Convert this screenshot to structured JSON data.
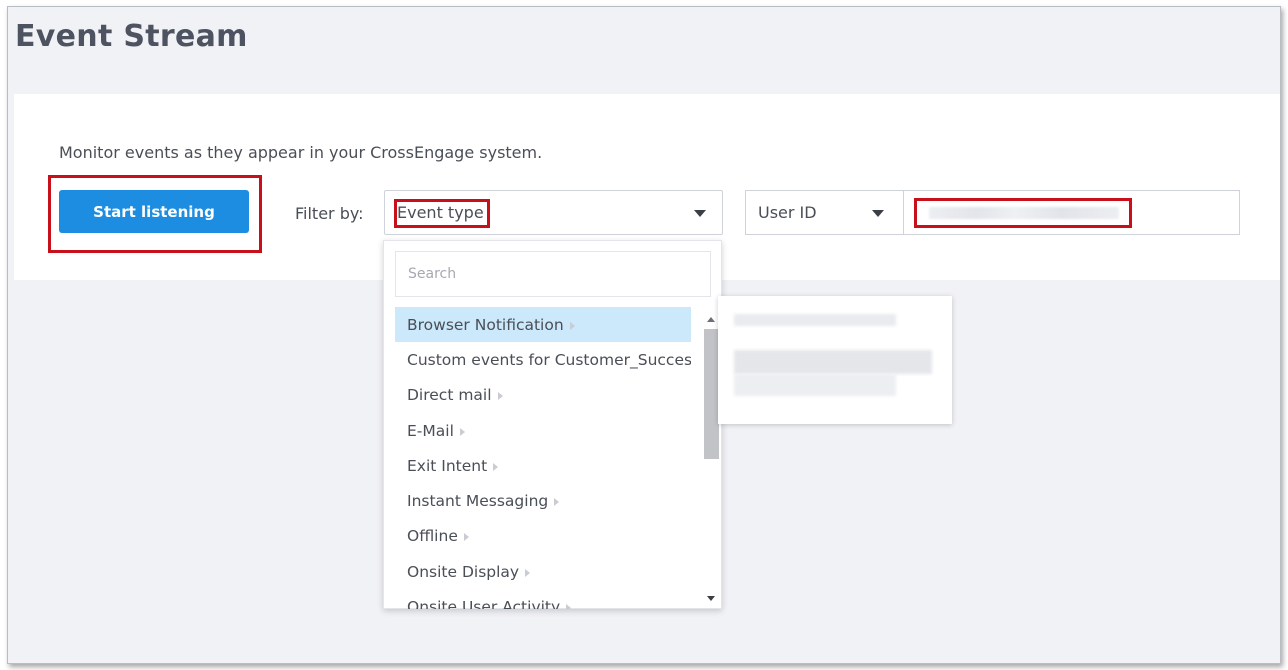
{
  "page": {
    "title": "Event Stream"
  },
  "panel": {
    "description": "Monitor events as they appear in your CrossEngage system.",
    "start_button": "Start listening",
    "filter_label": "Filter by:",
    "event_select": {
      "value": "Event type"
    },
    "user_select": {
      "value": "User ID"
    },
    "user_input": {
      "value": ""
    }
  },
  "dropdown": {
    "search_placeholder": "Search",
    "items": [
      {
        "label": "Browser Notification",
        "active": true
      },
      {
        "label": "Custom events for Customer_Success"
      },
      {
        "label": "Direct mail"
      },
      {
        "label": "E-Mail"
      },
      {
        "label": "Exit Intent"
      },
      {
        "label": "Instant Messaging"
      },
      {
        "label": "Offline"
      },
      {
        "label": "Onsite Display"
      },
      {
        "label": "Onsite User Activity"
      }
    ]
  },
  "colors": {
    "primary_button": "#1c8de0",
    "highlight_box": "#c8101b",
    "active_item": "#cce8fb",
    "page_background": "#f1f2f6"
  },
  "icons": {
    "dropdown_caret": "caret-down-icon",
    "submenu_arrow": "chevron-right-icon"
  }
}
